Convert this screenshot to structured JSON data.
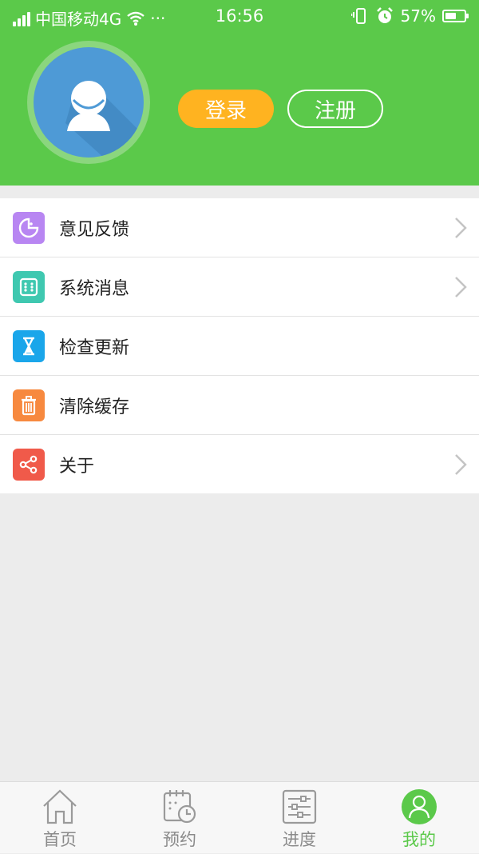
{
  "status_bar": {
    "carrier": "中国移动4G",
    "dots": "···",
    "time": "16:56",
    "battery_percent": "57%",
    "battery_level": 0.57
  },
  "profile": {
    "login_label": "登录",
    "register_label": "注册"
  },
  "menu": {
    "items": [
      {
        "label": "意见反馈",
        "icon": "pacman-feedback-icon",
        "color": "#b886f2",
        "has_chevron": true
      },
      {
        "label": "系统消息",
        "icon": "dice-message-icon",
        "color": "#3fc8b0",
        "has_chevron": true
      },
      {
        "label": "检查更新",
        "icon": "hourglass-icon",
        "color": "#1aa6ea",
        "has_chevron": false
      },
      {
        "label": "清除缓存",
        "icon": "trash-icon",
        "color": "#f7893f",
        "has_chevron": false
      },
      {
        "label": "关于",
        "icon": "share-icon",
        "color": "#f05a4a",
        "has_chevron": true
      }
    ]
  },
  "tabbar": {
    "tabs": [
      {
        "label": "首页",
        "icon": "house-icon",
        "active": false
      },
      {
        "label": "预约",
        "icon": "calendar-clock-icon",
        "active": false
      },
      {
        "label": "进度",
        "icon": "progress-sliders-icon",
        "active": false
      },
      {
        "label": "我的",
        "icon": "person-icon",
        "active": true
      }
    ]
  },
  "colors": {
    "brand_green": "#5bc94a",
    "login_orange": "#ffb320",
    "avatar_blue": "#4e9ad6"
  }
}
